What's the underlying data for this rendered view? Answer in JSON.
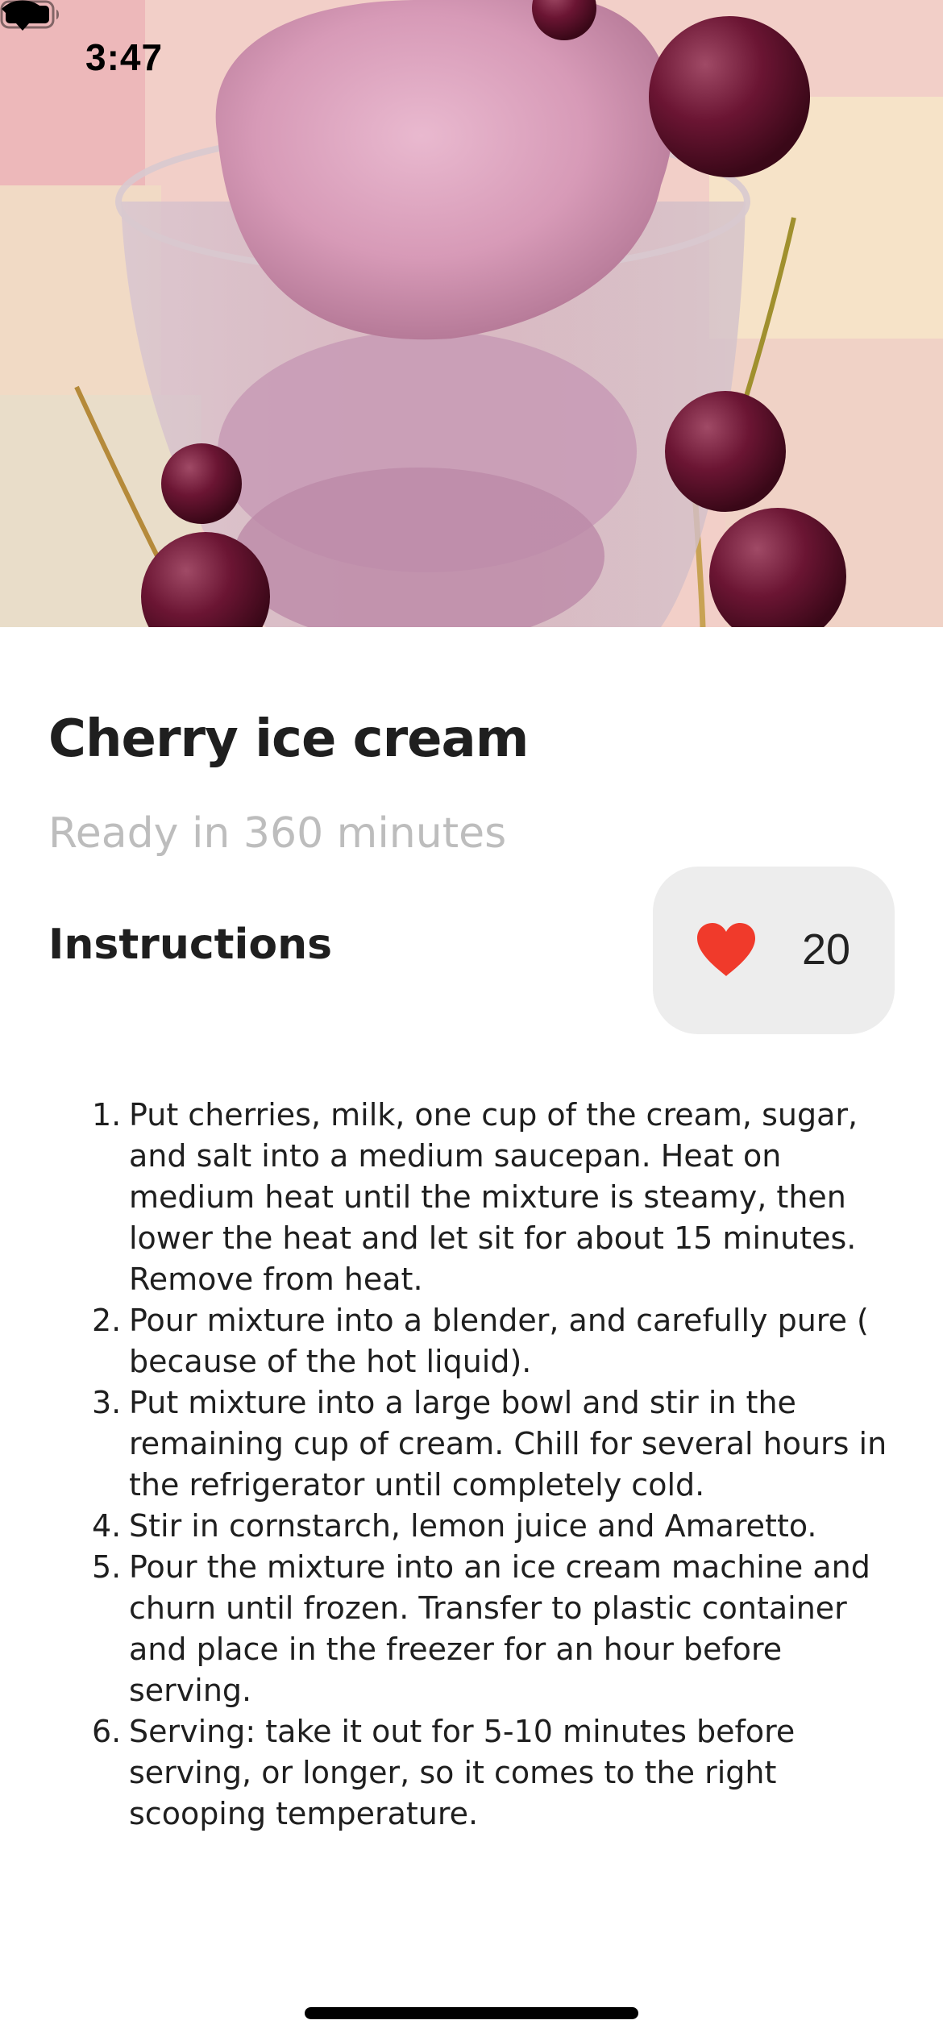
{
  "status_bar": {
    "time": "3:47",
    "icons": [
      "wifi-icon",
      "battery-icon"
    ]
  },
  "hero": {
    "image": "cherry-ice-cream-photo"
  },
  "recipe": {
    "title": "Cherry ice cream",
    "ready_in": "Ready in 360 minutes",
    "instructions_heading": "Instructions",
    "likes": {
      "icon": "heart-icon",
      "count": "20",
      "heart_color": "#f03a2b"
    },
    "steps": [
      {
        "num": "1.",
        "text": "Put cherries, milk, one cup of the cream, sugar, and salt into a medium saucepan. Heat on medium heat until the mixture is steamy, then lower the heat and let sit for about 15 minutes. Remove from heat."
      },
      {
        "num": "2.",
        "text": "Pour mixture into a blender, and carefully pure ( because of the hot liquid)."
      },
      {
        "num": "3.",
        "text": "Put mixture into a large bowl and stir in the remaining cup of cream. Chill for several hours in the refrigerator until completely cold."
      },
      {
        "num": "4.",
        "text": "Stir in cornstarch, lemon juice and Amaretto."
      },
      {
        "num": "5.",
        "text": "Pour the mixture into an ice cream machine and churn until frozen. Transfer to plastic container and place in the freezer for an hour before serving."
      },
      {
        "num": "6.",
        "text": "Serving: take it out for 5-10 minutes before serving, or longer, so it comes to the right scooping temperature."
      }
    ]
  }
}
